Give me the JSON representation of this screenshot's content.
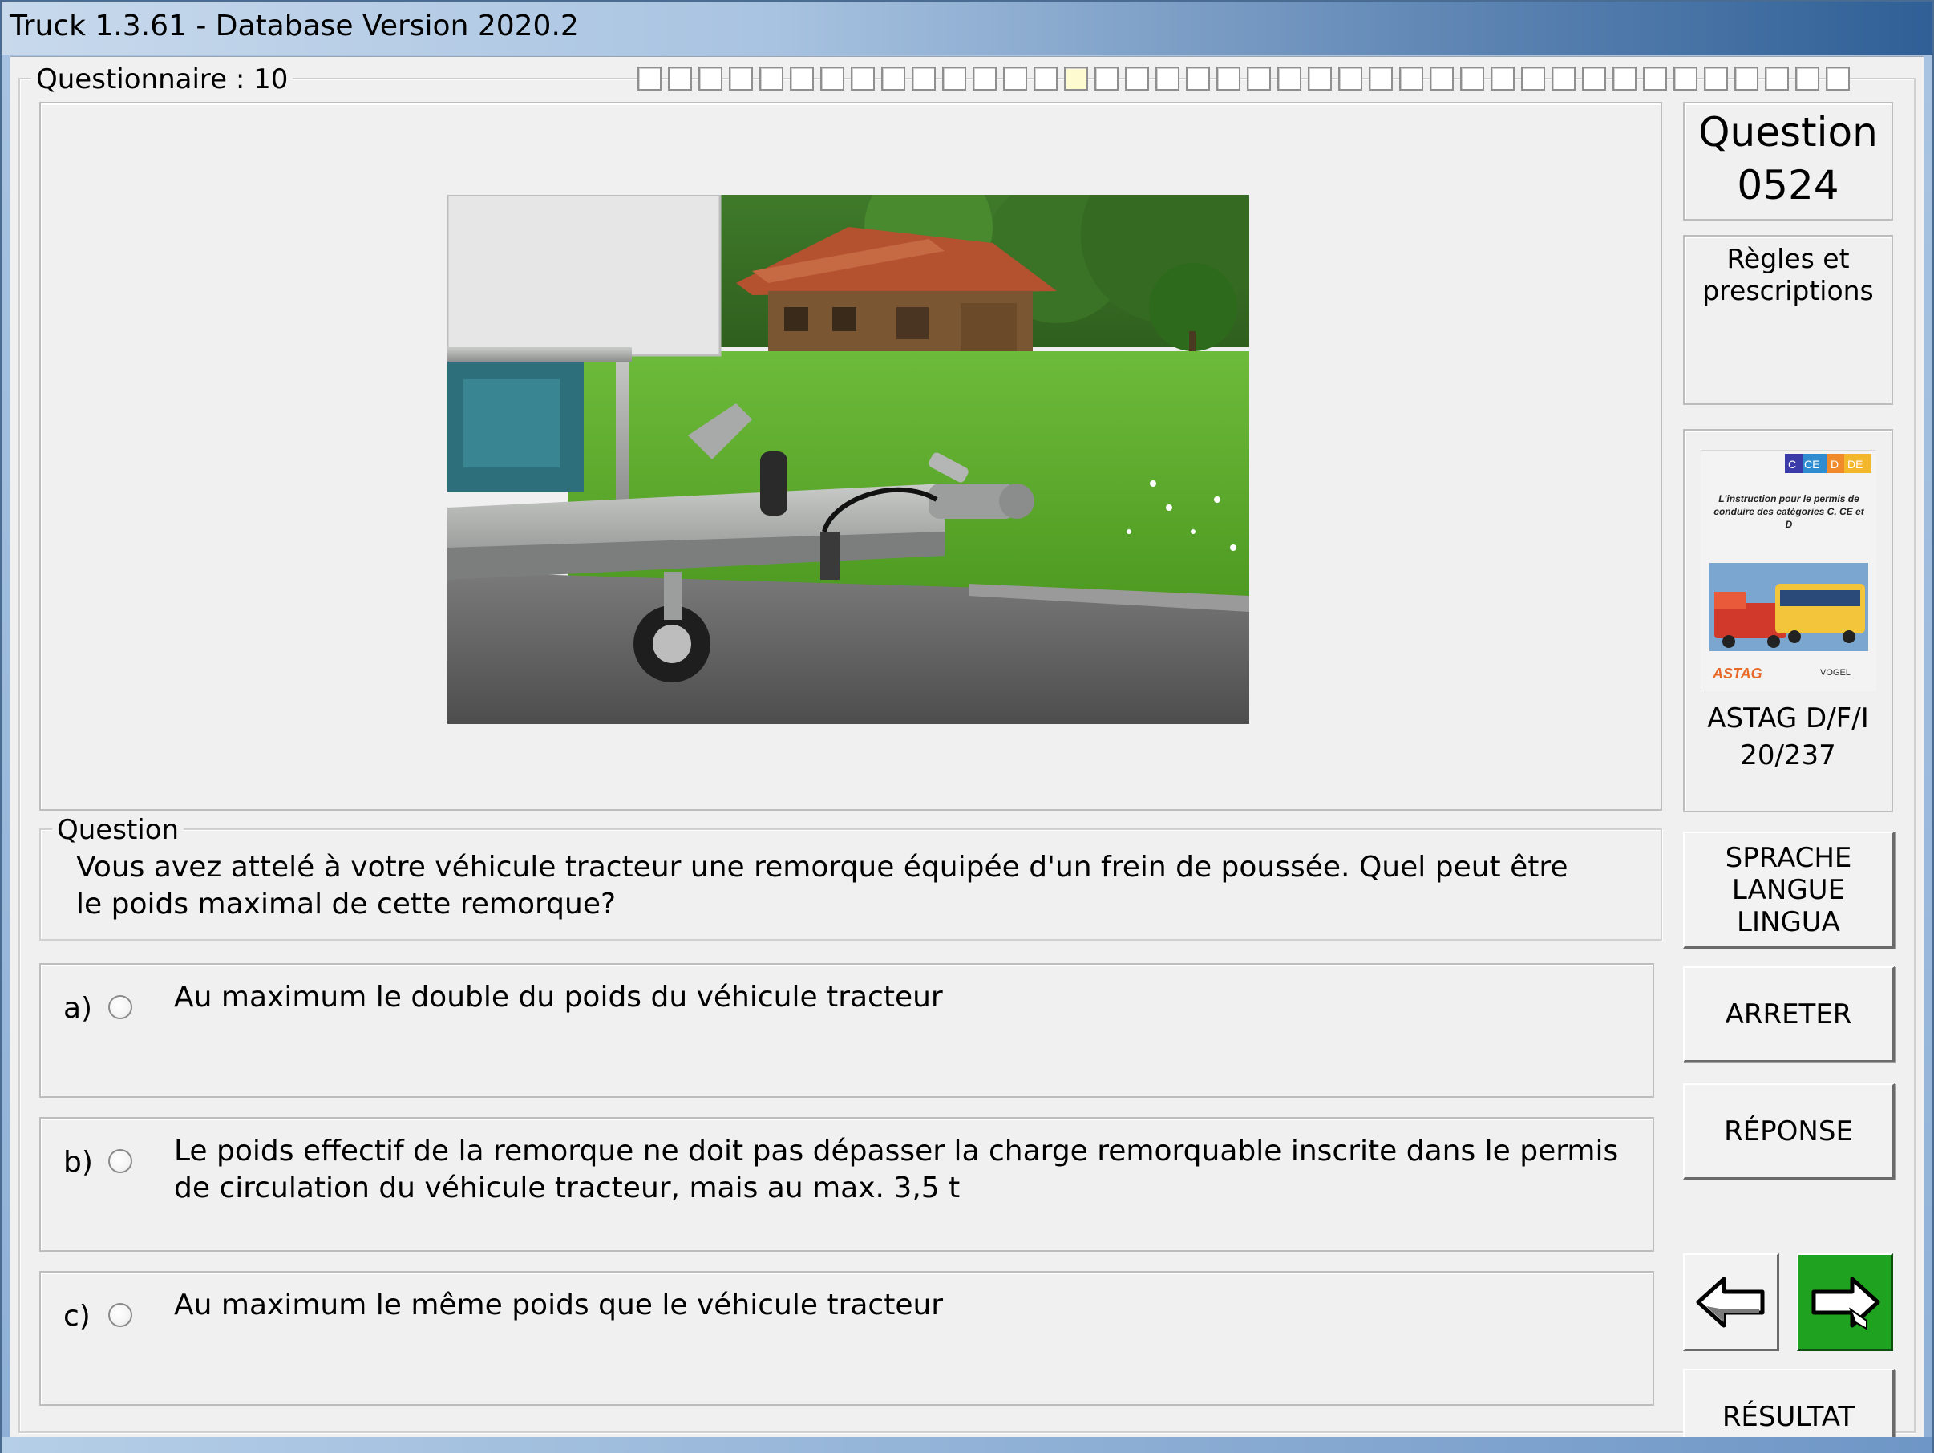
{
  "window": {
    "title": "Truck 1.3.61 - Database Version 2020.2"
  },
  "questionnaire": {
    "label": "Questionnaire : 10",
    "progress_total": 40,
    "progress_current": 15
  },
  "question_panel": {
    "legend": "Question",
    "text": "Vous avez attelé à votre véhicule tracteur une remorque équipée d'un frein de poussée. Quel peut être le poids maximal de cette remorque?"
  },
  "answers": [
    {
      "letter": "a)",
      "text": "Au maximum le double du poids du véhicule tracteur"
    },
    {
      "letter": "b)",
      "text": "Le poids effectif de la remorque ne doit pas dépasser la charge remorquable inscrite dans le permis de circulation du véhicule tracteur, mais au max. 3,5 t"
    },
    {
      "letter": "c)",
      "text": "Au maximum le même poids que le véhicule tracteur"
    }
  ],
  "sidebar": {
    "question_label": "Question",
    "question_number": "0524",
    "category": "Règles et prescriptions",
    "book": {
      "cover_badges": [
        "C",
        "CE",
        "D",
        "DE"
      ],
      "cover_text": "L'instruction pour le permis de conduire des catégories C, CE et D",
      "cover_logos": [
        "ASTAG",
        "VOGEL"
      ],
      "source": "ASTAG D/F/I",
      "reference": "20/237"
    }
  },
  "buttons": {
    "language": "SPRACHE LANGUE LINGUA",
    "stop": "ARRETER",
    "answer": "RÉPONSE",
    "result": "RÉSULTAT"
  },
  "colors": {
    "next_button_bg": "#1fa21f",
    "window_bg": "#f0f0f0",
    "titlebar_accent": "#2f5f96"
  },
  "icons": {
    "back": "arrow-left-icon",
    "next": "arrow-right-icon"
  }
}
